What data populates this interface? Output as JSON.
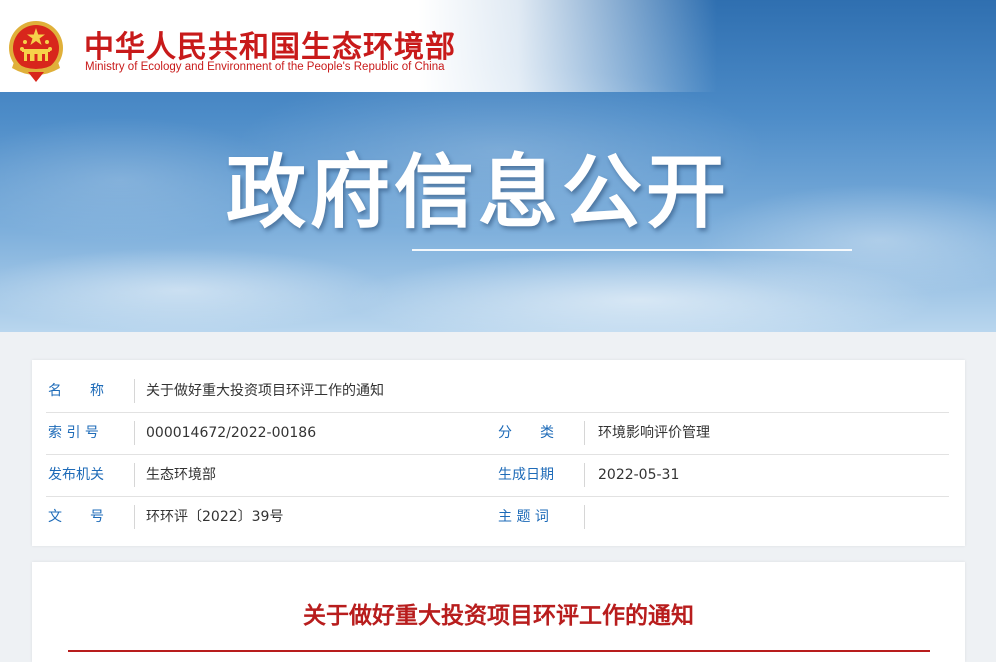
{
  "header": {
    "ministry_cn": "中华人民共和国生态环境部",
    "ministry_en": "Ministry of Ecology and Environment of the People's Republic of China",
    "emblem_icon": "national-emblem-icon",
    "brand_color": "#c81a1a"
  },
  "banner": {
    "title": "政府信息公开"
  },
  "info": {
    "label_color": "#1e6bb8",
    "rows": [
      {
        "label": "名　　称",
        "value": "关于做好重大投资项目环评工作的通知"
      },
      {
        "label": "索 引 号",
        "value": "000014672/2022-00186",
        "label2": "分　　类",
        "value2": "环境影响评价管理"
      },
      {
        "label": "发布机关",
        "value": "生态环境部",
        "label2": "生成日期",
        "value2": "2022-05-31"
      },
      {
        "label": "文　　号",
        "value": "环环评〔2022〕39号",
        "label2": "主 题 词",
        "value2": ""
      }
    ]
  },
  "article": {
    "title": "关于做好重大投资项目环评工作的通知",
    "title_color": "#b81d1d"
  }
}
